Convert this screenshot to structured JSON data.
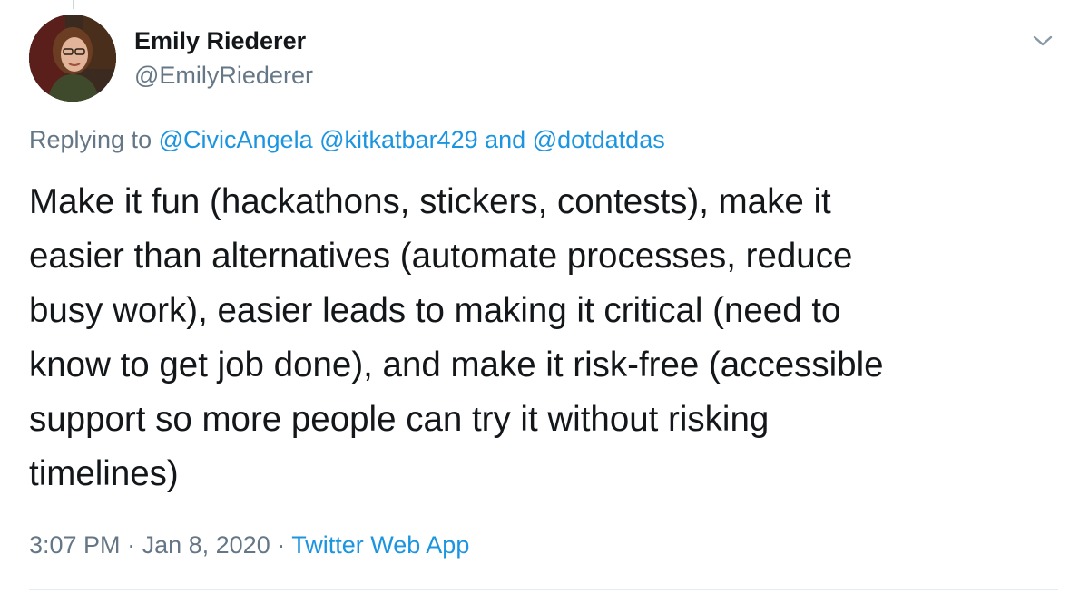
{
  "user": {
    "display_name": "Emily Riederer",
    "handle": "@EmilyRiederer"
  },
  "icons": {
    "avatar": "avatar-photo",
    "menu": "chevron-down-icon"
  },
  "reply": {
    "prefix": "Replying to",
    "mention_1": "@CivicAngela",
    "mention_2": "@kitkatbar429",
    "conjunction": "and",
    "mention_3": "@dotdatdas"
  },
  "tweet": {
    "lines": [
      "Make it fun (hackathons, stickers, contests), make it",
      "easier than alternatives (automate processes, reduce",
      "busy work), easier leads to making it critical (need to",
      "know to get job done), and make it risk-free (accessible",
      "support so more people can try it without risking",
      "timelines)"
    ]
  },
  "meta": {
    "time": "3:07 PM",
    "separator": "·",
    "date": "Jan 8, 2020",
    "source": "Twitter Web App"
  },
  "colors": {
    "link": "#1b95e0",
    "secondary_text": "#657786",
    "primary_text": "#14171a",
    "divider": "#e6ecf0"
  }
}
